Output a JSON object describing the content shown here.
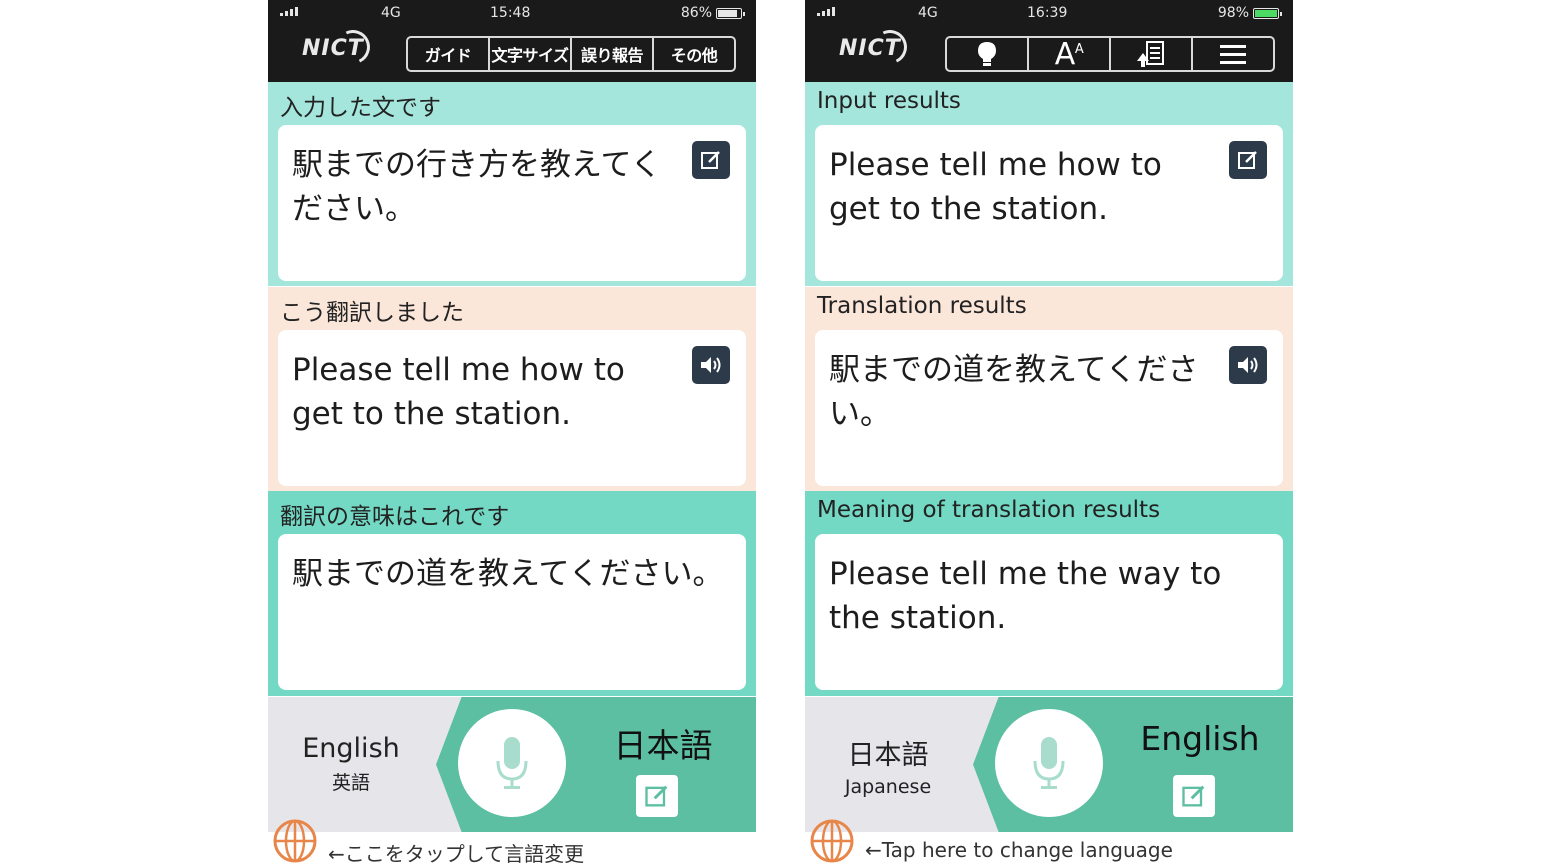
{
  "left": {
    "status": {
      "network": "4G",
      "time": "15:48",
      "battery": "86%"
    },
    "logo": "NICT",
    "tabs": [
      "ガイド",
      "文字サイズ",
      "誤り報告",
      "その他"
    ],
    "input": {
      "label": "入力した文です",
      "text": "駅までの行き方を教えてください。"
    },
    "translation": {
      "label": "こう翻訳しました",
      "text": "Please tell me how to get to the station."
    },
    "back_translation": {
      "label": "翻訳の意味はこれです",
      "text": "駅までの道を教えてください。"
    },
    "source_language": {
      "name": "English",
      "sub": "英語"
    },
    "target_language": "日本語",
    "hint": "←ここをタップして言語変更"
  },
  "right": {
    "status": {
      "network": "4G",
      "time": "16:39",
      "battery": "98%"
    },
    "logo": "NICT",
    "toolbar_icons": [
      "lightbulb-icon",
      "font-size-icon",
      "report-icon",
      "menu-icon"
    ],
    "input": {
      "label": "Input results",
      "text": "Please tell me how to get to the station."
    },
    "translation": {
      "label": "Translation results",
      "text": "駅までの道を教えてください。"
    },
    "back_translation": {
      "label": "Meaning of translation results",
      "text": "Please tell me the way to the station."
    },
    "source_language": {
      "name": "日本語",
      "sub": "Japanese"
    },
    "target_language": "English",
    "hint": "←Tap here to change language"
  },
  "colors": {
    "header": "#1a1a1a",
    "input_section": "#a4e6dc",
    "translation_section": "#fbe6da",
    "meaning_section": "#74d9c4",
    "target_panel": "#5cbfa1",
    "icon_button": "#2d3a4a",
    "globe": "#e8864a"
  }
}
